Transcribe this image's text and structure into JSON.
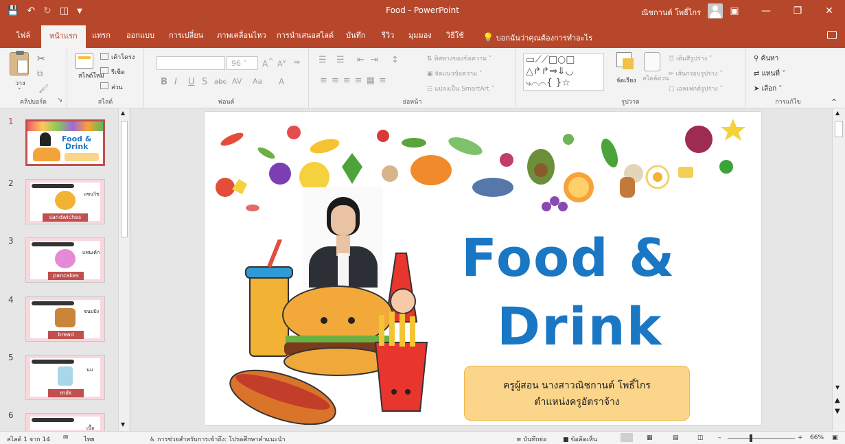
{
  "window": {
    "title": "Food  -  PowerPoint",
    "user": "ณิชกานต์ โพธิ์ไกร"
  },
  "tabs": [
    {
      "label": "ไฟล์"
    },
    {
      "label": "หน้าแรก"
    },
    {
      "label": "แทรก"
    },
    {
      "label": "ออกแบบ"
    },
    {
      "label": "การเปลี่ยน"
    },
    {
      "label": "ภาพเคลื่อนไหว"
    },
    {
      "label": "การนำเสนอสไลด์"
    },
    {
      "label": "บันทึก"
    },
    {
      "label": "รีวิว"
    },
    {
      "label": "มุมมอง"
    },
    {
      "label": "วิธีใช้"
    }
  ],
  "tellme": "บอกฉันว่าคุณต้องการทำอะไร",
  "ribbon": {
    "clipboard": {
      "paste": "วาง",
      "group": "คลิปบอร์ด"
    },
    "slides": {
      "new_slide": "สไลด์ใหม่",
      "layout": "เค้าโครง",
      "reset": "รีเซ็ต",
      "section": "ส่วน",
      "group": "สไลด์"
    },
    "font": {
      "size": "96",
      "group": "ฟอนต์"
    },
    "paragraph": {
      "text_direction": "ทิศทางของข้อความ",
      "align_text": "จัดแนวข้อความ",
      "smartart": "แปลงเป็น SmartArt",
      "group": "ย่อหน้า"
    },
    "drawing": {
      "arrange": "จัดเรียง",
      "quick_styles": "สไตล์ด่วน",
      "shape_fill": "เติมสีรูปร่าง",
      "shape_outline": "เส้นกรอบรูปร่าง",
      "shape_effects": "เอฟเฟกต์รูปร่าง",
      "group": "รูปวาด"
    },
    "editing": {
      "find": "ค้นหา",
      "replace": "แทนที่",
      "select": "เลือก",
      "group": "การแก้ไข"
    }
  },
  "thumbnails": [
    {
      "num": "1",
      "title1": "Food &",
      "title2": "Drink"
    },
    {
      "num": "2",
      "word": "sandwiches",
      "thai": "แซนวิช"
    },
    {
      "num": "3",
      "word": "pancakes",
      "thai": "แพนเค้ก"
    },
    {
      "num": "4",
      "word": "bread",
      "thai": "ขนมปัง"
    },
    {
      "num": "5",
      "word": "milk",
      "thai": "นม"
    },
    {
      "num": "6",
      "thai": "เนื้อ"
    }
  ],
  "slide": {
    "title_line1": "Food &",
    "title_line2": "Drink",
    "teacher_line1": "ครูผู้สอน นางสาวณิชกานต์  โพธิ์ไกร",
    "teacher_line2": "ตำแหน่งครูอัตราจ้าง"
  },
  "status": {
    "slide_count": "สไลด์ 1 จาก 14",
    "language": "ไทย",
    "accessibility": "การช่วยสำหรับการเข้าถึง: โปรดศึกษาคำแนะนำ",
    "notes": "บันทึกย่อ",
    "comments": "ข้อคิดเห็น",
    "zoom": "66%"
  },
  "colors": {
    "accent": "#b7472a",
    "title_blue": "#1a77c4",
    "teacher_box": "#fbd58a"
  }
}
